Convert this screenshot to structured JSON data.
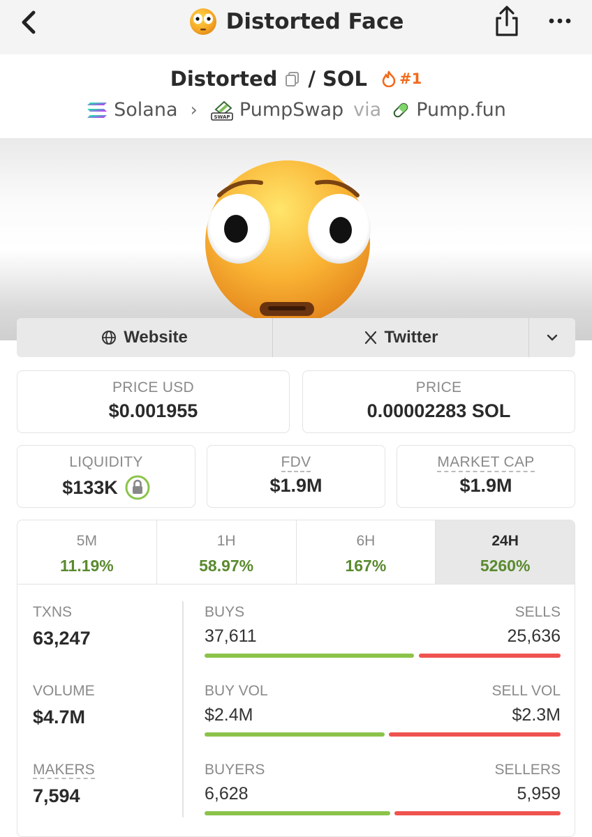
{
  "nav": {
    "title": "Distorted Face"
  },
  "pair": {
    "base": "Distorted",
    "separator": "/",
    "quote": "SOL",
    "rank": "#1",
    "chain": "Solana",
    "dex": "PumpSwap",
    "via": "via",
    "launchpad": "Pump.fun",
    "dex_badge": "SWAP"
  },
  "links": {
    "website": "Website",
    "twitter": "Twitter"
  },
  "stats": {
    "price_usd_label": "PRICE USD",
    "price_usd": "$0.001955",
    "price_label": "PRICE",
    "price": "0.00002283 SOL",
    "liquidity_label": "LIQUIDITY",
    "liquidity": "$133K",
    "fdv_label": "FDV",
    "fdv": "$1.9M",
    "mcap_label": "MARKET CAP",
    "mcap": "$1.9M"
  },
  "timeframes": [
    {
      "label": "5M",
      "value": "11.19%"
    },
    {
      "label": "1H",
      "value": "58.97%"
    },
    {
      "label": "6H",
      "value": "167%"
    },
    {
      "label": "24H",
      "value": "5260%"
    }
  ],
  "active_timeframe": "24H",
  "metrics": {
    "txns_label": "TXNS",
    "txns": "63,247",
    "volume_label": "VOLUME",
    "volume": "$4.7M",
    "makers_label": "MAKERS",
    "makers": "7,594",
    "buys_label": "BUYS",
    "buys": "37,611",
    "sells_label": "SELLS",
    "sells": "25,636",
    "buy_vol_label": "BUY VOL",
    "buy_vol": "$2.4M",
    "sell_vol_label": "SELL VOL",
    "sell_vol": "$2.3M",
    "buyers_label": "BUYERS",
    "buyers": "6,628",
    "sellers_label": "SELLERS",
    "sellers": "5,959"
  },
  "bars": {
    "txns_buy_fraction": 0.595,
    "volume_buy_fraction": 0.511,
    "makers_buy_fraction": 0.527
  },
  "colors": {
    "positive": "#5a8a2f",
    "buy_bar": "#8bc34a",
    "sell_bar": "#ef5350",
    "rank": "#f26a1b"
  }
}
